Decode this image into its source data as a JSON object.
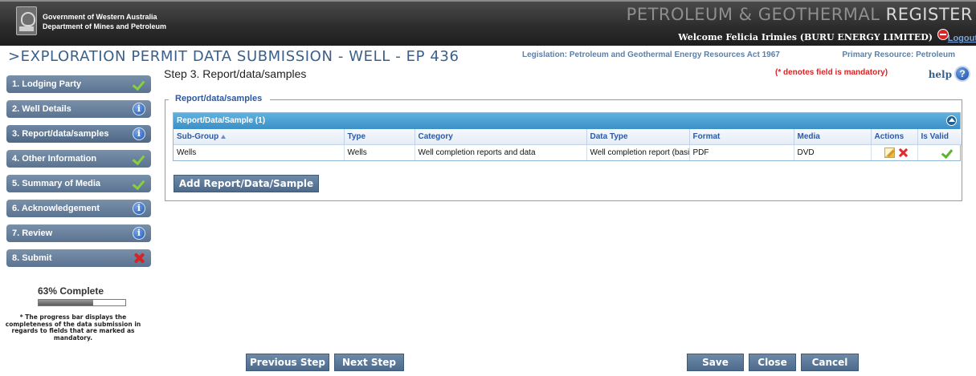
{
  "header": {
    "gov_line1": "Government of Western Australia",
    "gov_line2": "Department of Mines and Petroleum",
    "register_title_prefix": "PETROLEUM & GEOTHERMAL ",
    "register_title_suffix": "REGISTER",
    "welcome": "Welcome Felicia Irimies (BURU ENERGY LIMITED)",
    "logout": "Logout"
  },
  "title_row": {
    "page_title": ">EXPLORATION PERMIT DATA SUBMISSION - WELL - EP 436",
    "legislation": "Legislation: Petroleum and Geothermal Energy Resources Act 1967",
    "primary_resource": "Primary Resource: Petroleum"
  },
  "sidebar": {
    "steps": [
      {
        "label": "1. Lodging Party",
        "status_icon": "check-icon"
      },
      {
        "label": "2. Well Details",
        "status_icon": "info-icon"
      },
      {
        "label": "3. Report/data/samples",
        "status_icon": "info-icon"
      },
      {
        "label": "4. Other Information",
        "status_icon": "check-icon"
      },
      {
        "label": "5. Summary of Media",
        "status_icon": "check-icon"
      },
      {
        "label": "6. Acknowledgement",
        "status_icon": "info-icon"
      },
      {
        "label": "7. Review",
        "status_icon": "info-icon"
      },
      {
        "label": "8. Submit",
        "status_icon": "x-icon"
      }
    ],
    "progress_label": "63% Complete",
    "progress_fraction": 0.63,
    "progress_note": "* The progress bar displays the completeness of the data submission in regards to fields that are marked as mandatory."
  },
  "main": {
    "step_heading": "Step 3.  Report/data/samples",
    "mandatory_note": "(* denotes field is mandatory)",
    "help": "help",
    "help_icon_glyph": "?",
    "legend": "Report/data/samples",
    "grid_title": "Report/Data/Sample (1)",
    "columns": [
      "Sub-Group",
      "Type",
      "Category",
      "Data Type",
      "Format",
      "Media",
      "Actions",
      "Is Valid"
    ],
    "rows": [
      {
        "sub_group": "Wells",
        "type": "Wells",
        "category": "Well completion reports and data",
        "data_type": "Well completion report (basic",
        "format": "PDF",
        "media": "DVD"
      }
    ],
    "add_button": "Add Report/Data/Sample"
  },
  "footer": {
    "previous": "Previous Step",
    "next": "Next Step",
    "save": "Save",
    "close": "Close",
    "cancel": "Cancel"
  }
}
